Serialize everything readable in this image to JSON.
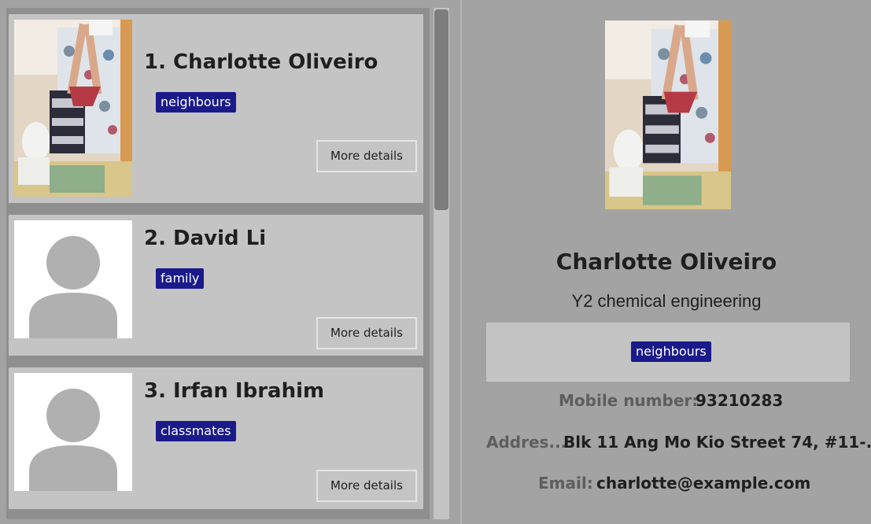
{
  "contacts": [
    {
      "index_name": "1. Charlotte Oliveiro",
      "tag": "neighbours",
      "button": "More details"
    },
    {
      "index_name": "2. David Li",
      "tag": "family",
      "button": "More details"
    },
    {
      "index_name": "3. Irfan Ibrahim",
      "tag": "classmates",
      "button": "More details"
    }
  ],
  "detail": {
    "name": "Charlotte Oliveiro",
    "subtitle": "Y2 chemical engineering",
    "tag": "neighbours",
    "mobile_label": "Mobile number:",
    "mobile_value": "93210283",
    "address_label": "Addres...",
    "address_value": "Blk 11 Ang Mo Kio Street 74, #11-...",
    "email_label": "Email:",
    "email_value": "charlotte@example.com"
  },
  "colors": {
    "tag_background": "#1a1a8a",
    "card_background": "#c4c4c4",
    "pane_background": "#a3a3a3"
  },
  "icons": {
    "placeholder_avatar": "person-silhouette-icon"
  }
}
